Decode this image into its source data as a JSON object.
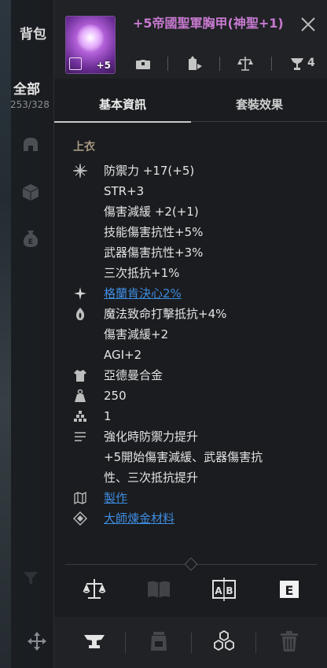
{
  "inventory": {
    "title": "背包",
    "filter_label": "全部",
    "count": "253/328"
  },
  "item": {
    "name": "+5帝國聖軍胸甲(神聖+1)",
    "enhance": "+5",
    "rarity_color": "#c77ad0",
    "trophy_count": "4"
  },
  "tabs": [
    {
      "label": "基本資訊",
      "active": true
    },
    {
      "label": "套裝效果",
      "active": false
    }
  ],
  "category": "上衣",
  "stats": [
    {
      "icon": "defense-star-icon",
      "text": "防禦力 +17(+5)"
    },
    {
      "icon": "",
      "text": "STR+3"
    },
    {
      "icon": "",
      "text": "傷害減緩 +2(+1)"
    },
    {
      "icon": "",
      "text": "技能傷害抗性+5%"
    },
    {
      "icon": "",
      "text": "武器傷害抗性+3%"
    },
    {
      "icon": "",
      "text": "三次抵抗+1%"
    },
    {
      "icon": "sparkle-icon",
      "text": "格蘭肯決心2%",
      "link": true
    },
    {
      "icon": "flame-gem-icon",
      "text": "魔法致命打擊抵抗+4%"
    },
    {
      "icon": "",
      "text": "傷害減緩+2"
    },
    {
      "icon": "",
      "text": "AGI+2"
    },
    {
      "icon": "armor-material-icon",
      "text": "亞德曼合金"
    },
    {
      "icon": "weight-icon",
      "text": "250"
    },
    {
      "icon": "stack-icon",
      "text": "1"
    },
    {
      "icon": "description-lines-icon",
      "text": "強化時防禦力提升"
    },
    {
      "icon": "",
      "text": "+5開始傷害減緩、武器傷害抗"
    },
    {
      "icon": "",
      "text": "性、三次抵抗提升"
    },
    {
      "icon": "map-icon",
      "text": "製作",
      "link": true
    },
    {
      "icon": "diamond-target-icon",
      "text": "大師煉金材料",
      "link": true
    }
  ],
  "colors": {
    "link": "#3f8bdf",
    "category": "#a79a84",
    "background": "#1a1c1f"
  }
}
